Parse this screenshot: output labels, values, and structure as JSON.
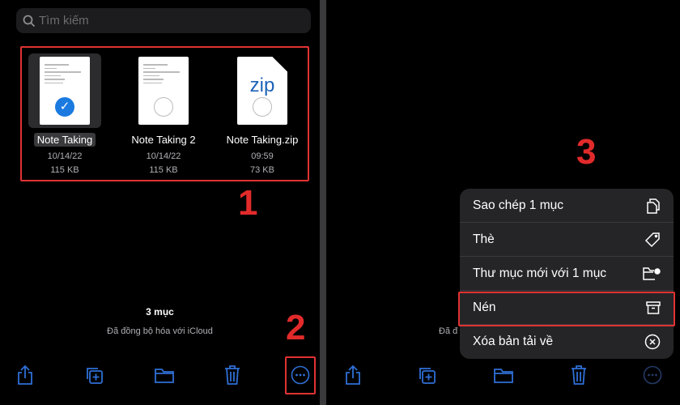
{
  "left": {
    "search_placeholder": "Tìm kiếm",
    "files": [
      {
        "name": "Note Taking",
        "date": "10/14/22",
        "size": "115 KB",
        "selected": true
      },
      {
        "name": "Note Taking 2",
        "date": "10/14/22",
        "size": "115 KB",
        "selected": false
      },
      {
        "name": "Note Taking.zip",
        "date": "09:59",
        "size": "73 KB",
        "selected": false,
        "thumb_label": "zip"
      }
    ],
    "status": {
      "count": "3 mục",
      "sync": "Đã đồng bộ hóa với iCloud"
    },
    "toolbar": [
      "share-icon",
      "duplicate-icon",
      "folder-icon",
      "trash-icon",
      "more-icon"
    ]
  },
  "right": {
    "status_partial": "Đã đ",
    "menu": [
      {
        "label": "Sao chép 1 mục",
        "icon": "copy-icon"
      },
      {
        "label": "Thè",
        "icon": "tag-icon"
      },
      {
        "label": "Thư mục mới với 1 mục",
        "icon": "new-folder-icon"
      },
      {
        "label": "Nén",
        "icon": "archive-icon",
        "highlighted": true
      },
      {
        "label": "Xóa bản tải về",
        "icon": "remove-download-icon"
      }
    ]
  },
  "annotations": {
    "step1": "1",
    "step2": "2",
    "step3": "3"
  },
  "colors": {
    "accent": "#1a7ae0",
    "annotation": "#e22a2a",
    "toolbar_icon": "#2f6fd6"
  }
}
